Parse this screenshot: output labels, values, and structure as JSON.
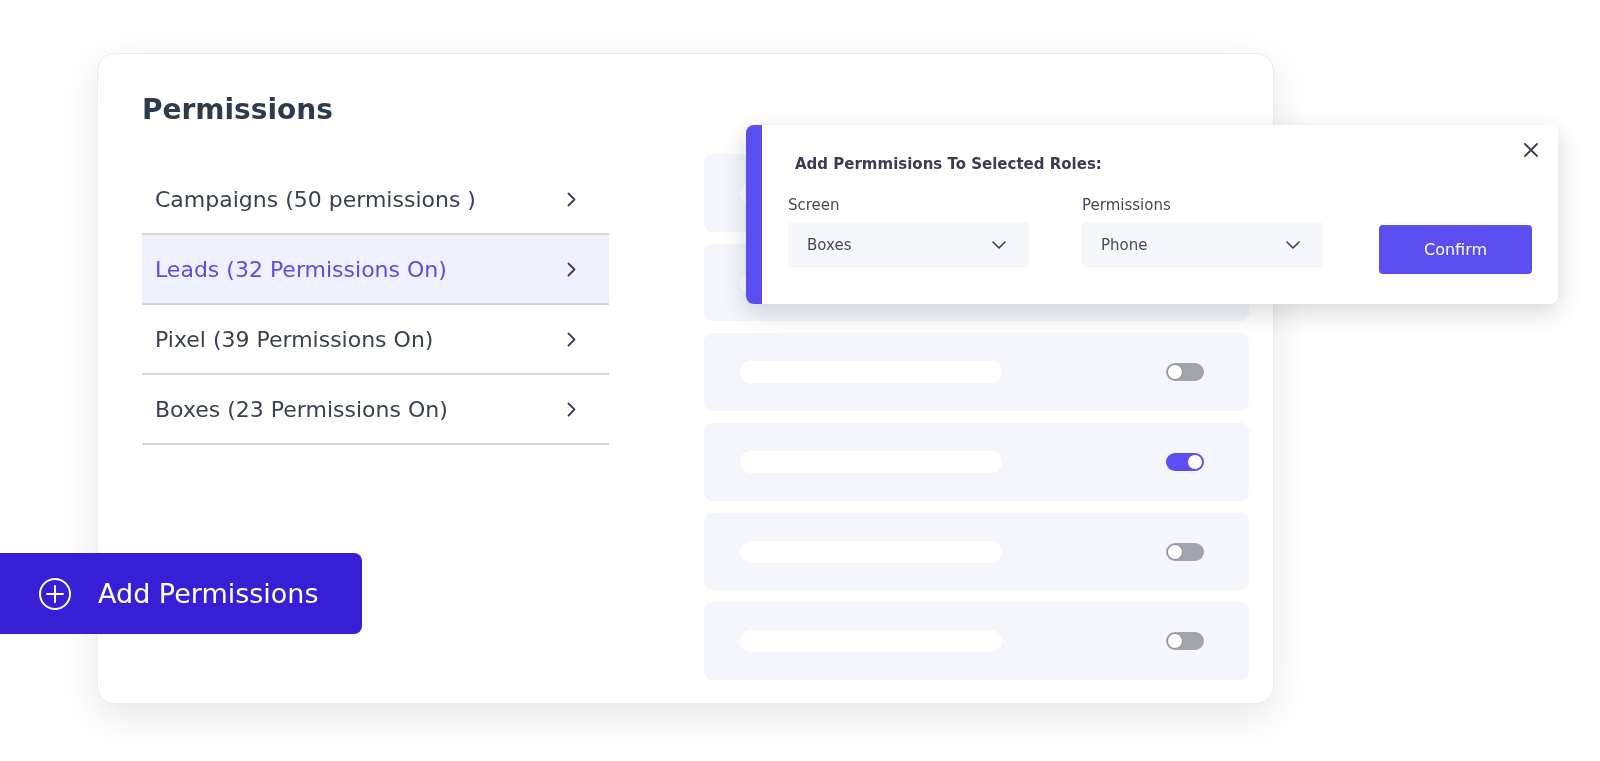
{
  "panel": {
    "title": "Permissions"
  },
  "categories": [
    {
      "label": "Campaigns (50 permissions )",
      "selected": false
    },
    {
      "label": "Leads (32 Permissions On)",
      "selected": true
    },
    {
      "label": "Pixel (39 Permissions On)",
      "selected": false
    },
    {
      "label": "Boxes (23 Permissions On)",
      "selected": false
    }
  ],
  "permission_rows": [
    {
      "kind": "plain"
    },
    {
      "kind": "plain"
    },
    {
      "kind": "toggle",
      "on": false
    },
    {
      "kind": "toggle",
      "on": true
    },
    {
      "kind": "toggle",
      "on": false
    },
    {
      "kind": "toggle",
      "on": false
    }
  ],
  "add_dialog": {
    "title": "Add Permmisions To Selected Roles:",
    "fields": [
      {
        "label": "Screen",
        "value": "Boxes"
      },
      {
        "label": "Permissions",
        "value": "Phone"
      }
    ],
    "confirm": "Confirm"
  },
  "add_button": {
    "label": "Add Permissions"
  }
}
